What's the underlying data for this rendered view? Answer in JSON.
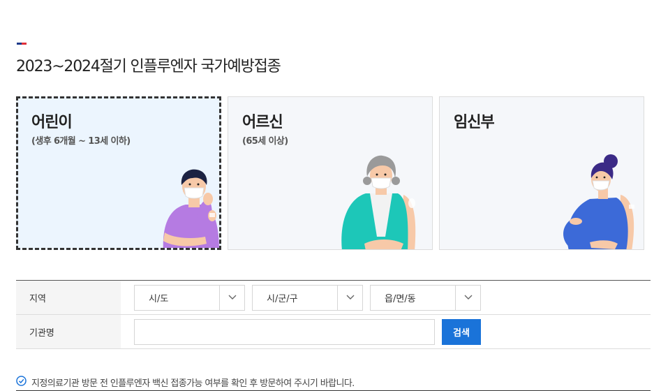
{
  "page": {
    "title": "2023~2024절기 인플루엔자 국가예방접종"
  },
  "cards": [
    {
      "title": "어린이",
      "subtitle": "(생후 6개월 ~ 13세 이하)",
      "selected": true
    },
    {
      "title": "어르신",
      "subtitle": "(65세 이상)",
      "selected": false
    },
    {
      "title": "임신부",
      "subtitle": "",
      "selected": false
    }
  ],
  "search": {
    "region_label": "지역",
    "sido": "시/도",
    "sigungu": "시/군/구",
    "eupmyeondong": "읍/면/동",
    "institution_label": "기관명",
    "institution_value": "",
    "search_button": "검색"
  },
  "notice": "지정의료기관 방문 전 인플루엔자 백신 접종가능 여부를 확인 후 방문하여 주시기 바랍니다.",
  "colors": {
    "accent": "#1a73d9",
    "selected_card_bg": "#ecf5fe",
    "card_bg": "#f5f7fa",
    "title_mark_blue": "#1d3a8a",
    "title_mark_red": "#e0303a"
  },
  "icons": {
    "dropdown": "chevron-down-icon",
    "notice": "check-circle-icon"
  }
}
